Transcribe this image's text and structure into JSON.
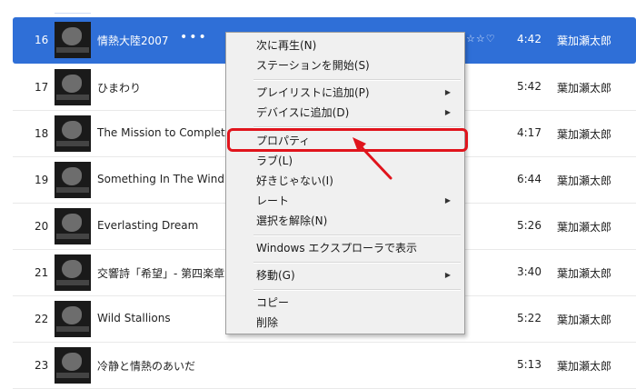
{
  "tracks": [
    {
      "num": "16",
      "title": "情熱大陸2007",
      "time": "4:42",
      "artist": "葉加瀬太郎",
      "selected": true,
      "more": "•••",
      "stars": "☆☆♡"
    },
    {
      "num": "17",
      "title": "ひまわり",
      "time": "5:42",
      "artist": "葉加瀬太郎"
    },
    {
      "num": "18",
      "title": "The Mission to Complete",
      "time": "4:17",
      "artist": "葉加瀬太郎"
    },
    {
      "num": "19",
      "title": "Something In The Wind",
      "time": "6:44",
      "artist": "葉加瀬太郎"
    },
    {
      "num": "20",
      "title": "Everlasting Dream",
      "time": "5:26",
      "artist": "葉加瀬太郎"
    },
    {
      "num": "21",
      "title": "交響詩「希望」- 第四楽章",
      "time": "3:40",
      "artist": "葉加瀬太郎"
    },
    {
      "num": "22",
      "title": "Wild Stallions",
      "time": "5:22",
      "artist": "葉加瀬太郎"
    },
    {
      "num": "23",
      "title": "冷静と情熱のあいだ",
      "time": "5:13",
      "artist": "葉加瀬太郎"
    }
  ],
  "context_menu": {
    "play_next": "次に再生(N)",
    "start_station": "ステーションを開始(S)",
    "add_to_playlist": "プレイリストに追加(P)",
    "add_to_device": "デバイスに追加(D)",
    "properties": "プロパティ",
    "love": "ラブ(L)",
    "dislike": "好きじゃない(I)",
    "rate": "レート",
    "deselect": "選択を解除(N)",
    "show_in_explorer": "Windows エクスプローラで表示",
    "move": "移動(G)",
    "copy": "コピー",
    "delete": "削除"
  },
  "colors": {
    "selection": "#2f6fd7",
    "highlight": "#e0141c"
  }
}
